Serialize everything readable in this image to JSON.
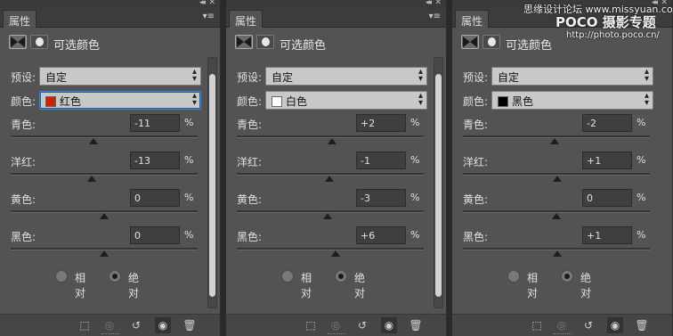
{
  "panels": [
    {
      "tab": "属性",
      "title": "可选颜色",
      "preset_label": "预设:",
      "preset_value": "自定",
      "color_label": "颜色:",
      "color_value": "红色",
      "swatch_color": "#cc2200",
      "sliders": [
        {
          "label": "青色:",
          "value": "-11",
          "unit": "%",
          "level": -11
        },
        {
          "label": "洋红:",
          "value": "-13",
          "unit": "%",
          "level": -13
        },
        {
          "label": "黄色:",
          "value": "0",
          "unit": "%",
          "level": 0
        },
        {
          "label": "黑色:",
          "value": "0",
          "unit": "%",
          "level": 0
        }
      ],
      "radio_relative": "相对",
      "radio_absolute": "绝对",
      "absolute_selected": true
    },
    {
      "tab": "属性",
      "title": "可选颜色",
      "preset_label": "预设:",
      "preset_value": "自定",
      "color_label": "颜色:",
      "color_value": "白色",
      "swatch_color": "#ffffff",
      "sliders": [
        {
          "label": "青色:",
          "value": "+2",
          "unit": "%",
          "level": 2
        },
        {
          "label": "洋红:",
          "value": "-1",
          "unit": "%",
          "level": -1
        },
        {
          "label": "黄色:",
          "value": "-3",
          "unit": "%",
          "level": -3
        },
        {
          "label": "黑色:",
          "value": "+6",
          "unit": "%",
          "level": 6
        }
      ],
      "radio_relative": "相对",
      "radio_absolute": "绝对",
      "absolute_selected": true
    },
    {
      "tab": "属性",
      "title": "可选颜色",
      "preset_label": "预设:",
      "preset_value": "自定",
      "color_label": "颜色:",
      "color_value": "黑色",
      "swatch_color": "#000000",
      "sliders": [
        {
          "label": "青色:",
          "value": "-2",
          "unit": "%",
          "level": -2
        },
        {
          "label": "洋红:",
          "value": "+1",
          "unit": "%",
          "level": 1
        },
        {
          "label": "黄色:",
          "value": "0",
          "unit": "%",
          "level": 0
        },
        {
          "label": "黑色:",
          "value": "+1",
          "unit": "%",
          "level": 1
        }
      ],
      "radio_relative": "相对",
      "radio_absolute": "绝对",
      "absolute_selected": true
    }
  ],
  "watermark": {
    "line1": "思缘设计论坛 www.missyuan.com",
    "brand": "POCO 摄影专题",
    "url": "http://photo.poco.cn/"
  },
  "colors": {
    "panel_bg": "#535353",
    "focus_border": "#3b84d6"
  }
}
